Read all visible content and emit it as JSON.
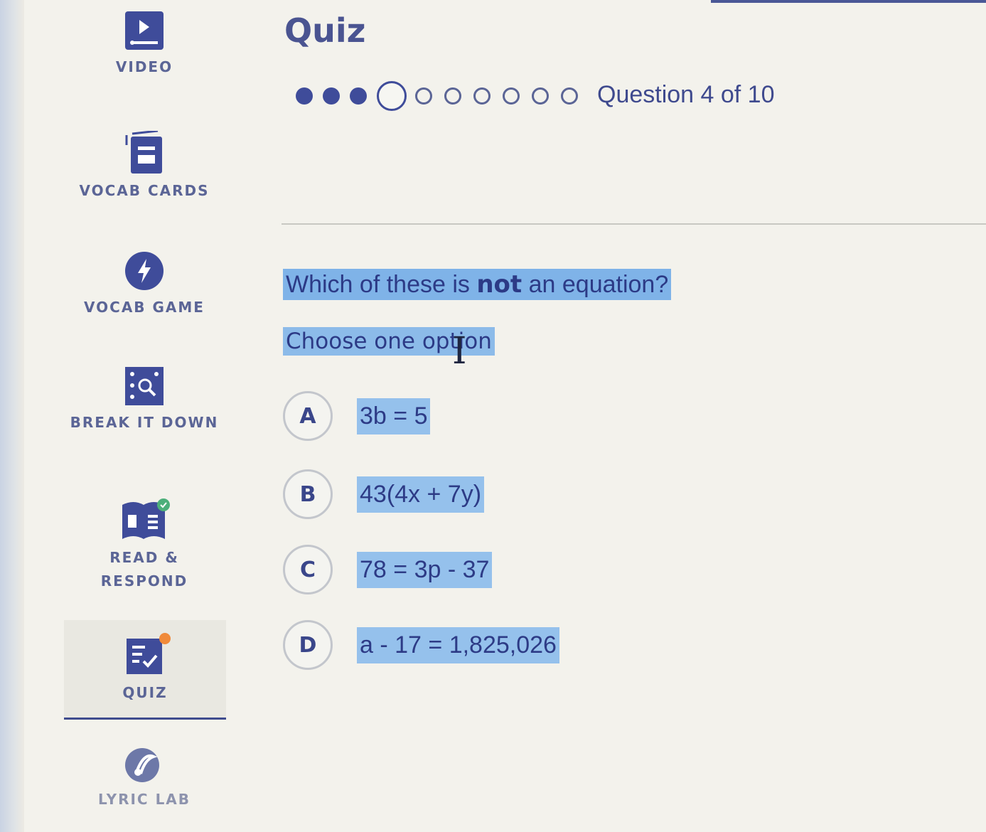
{
  "sidebar": {
    "items": [
      {
        "label": "VIDEO",
        "icon": "video-icon"
      },
      {
        "label": "VOCAB CARDS",
        "icon": "vocab-cards-icon"
      },
      {
        "label": "VOCAB GAME",
        "icon": "lightning-icon"
      },
      {
        "label": "BREAK IT DOWN",
        "icon": "magnifier-icon"
      },
      {
        "label": "READ & RESPOND",
        "icon": "book-icon"
      },
      {
        "label": "QUIZ",
        "icon": "quiz-icon",
        "active": true
      },
      {
        "label": "LYRIC LAB",
        "icon": "music-note-icon"
      }
    ]
  },
  "quiz": {
    "title": "Quiz",
    "progress_text": "Question 4 of 10",
    "current_question": 4,
    "total_questions": 10,
    "question_prefix": "Which of these is ",
    "question_emphasis": "not",
    "question_suffix": " an equation?",
    "instruction": "Choose one option",
    "options": [
      {
        "letter": "A",
        "text": "3b = 5"
      },
      {
        "letter": "B",
        "text": "43(4x + 7y)"
      },
      {
        "letter": "C",
        "text": "78 = 3p - 37"
      },
      {
        "letter": "D",
        "text": "a - 17 = 1,825,026"
      }
    ]
  },
  "colors": {
    "accent": "#3f4c9a",
    "highlight": "#7fb3e8",
    "background": "#f3f2ec"
  }
}
